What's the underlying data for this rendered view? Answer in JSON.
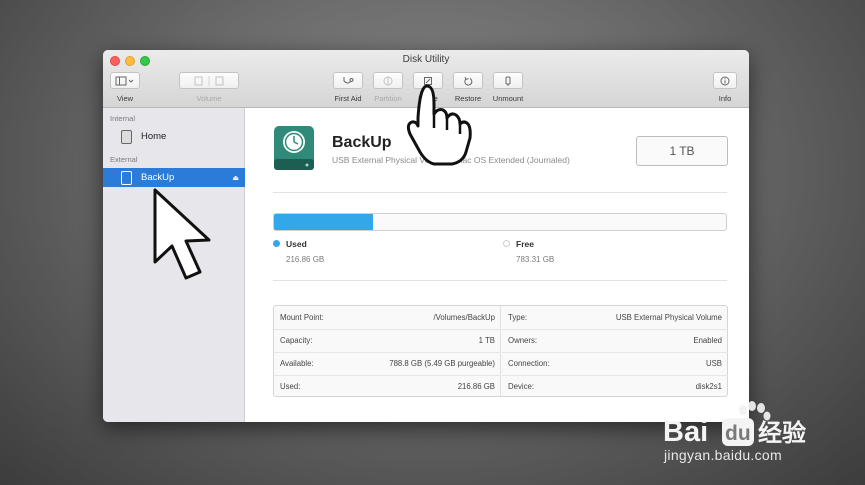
{
  "window": {
    "title": "Disk Utility"
  },
  "toolbar": {
    "view_label": "View",
    "volume_label": "Volume",
    "first_aid_label": "First Aid",
    "partition_label": "Partition",
    "erase_label": "Erase",
    "restore_label": "Restore",
    "unmount_label": "Unmount",
    "info_label": "Info"
  },
  "sidebar": {
    "internal_heading": "Internal",
    "external_heading": "External",
    "items": [
      {
        "label": "Home",
        "section": "internal",
        "selected": false
      },
      {
        "label": "BackUp",
        "section": "external",
        "selected": true
      }
    ]
  },
  "volume": {
    "name": "BackUp",
    "description": "USB External Physical Volume • Mac OS Extended (Journaled)",
    "size": "1 TB",
    "usage_fraction": 0.22
  },
  "usage": {
    "used_label": "Used",
    "used_value": "216.86 GB",
    "free_label": "Free",
    "free_value": "783.31 GB",
    "used_color": "#33a8e8"
  },
  "info": {
    "left": [
      {
        "key": "Mount Point:",
        "value": "/Volumes/BackUp"
      },
      {
        "key": "Capacity:",
        "value": "1 TB"
      },
      {
        "key": "Available:",
        "value": "788.8 GB (5.49 GB purgeable)"
      },
      {
        "key": "Used:",
        "value": "216.86 GB"
      }
    ],
    "right": [
      {
        "key": "Type:",
        "value": "USB External Physical Volume"
      },
      {
        "key": "Owners:",
        "value": "Enabled"
      },
      {
        "key": "Connection:",
        "value": "USB"
      },
      {
        "key": "Device:",
        "value": "disk2s1"
      }
    ]
  },
  "watermark": {
    "brand_latin": "Bai",
    "brand_du": "du",
    "brand_cn": "经验",
    "url": "jingyan.baidu.com"
  }
}
